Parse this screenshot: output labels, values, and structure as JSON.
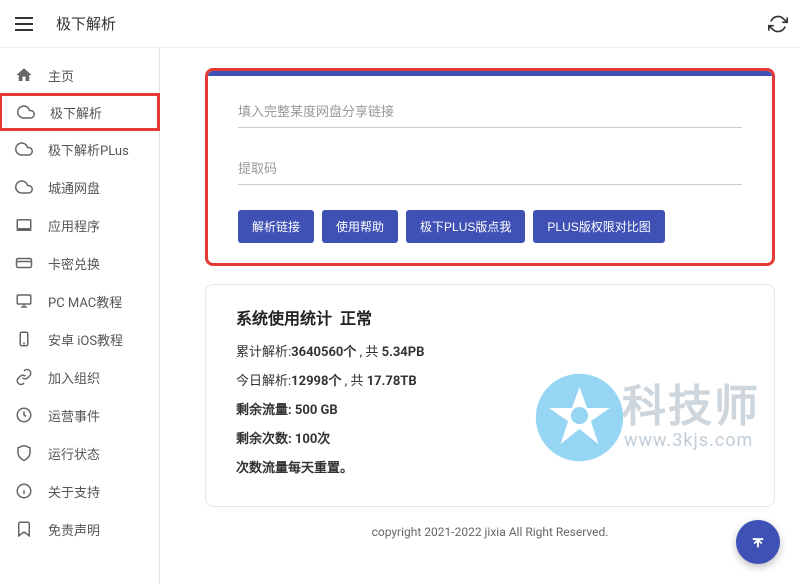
{
  "header": {
    "title": "极下解析"
  },
  "sidebar": {
    "items": [
      {
        "label": "主页",
        "icon": "home",
        "highlighted": false
      },
      {
        "label": "极下解析",
        "icon": "cloud",
        "highlighted": true
      },
      {
        "label": "极下解析PLus",
        "icon": "cloud",
        "highlighted": false
      },
      {
        "label": "城通网盘",
        "icon": "cloud",
        "highlighted": false
      },
      {
        "label": "应用程序",
        "icon": "laptop",
        "highlighted": false
      },
      {
        "label": "卡密兑换",
        "icon": "card",
        "highlighted": false
      },
      {
        "label": "PC MAC教程",
        "icon": "monitor",
        "highlighted": false
      },
      {
        "label": "安卓 iOS教程",
        "icon": "phone",
        "highlighted": false
      },
      {
        "label": "加入组织",
        "icon": "link",
        "highlighted": false
      },
      {
        "label": "运营事件",
        "icon": "clock",
        "highlighted": false
      },
      {
        "label": "运行状态",
        "icon": "shield",
        "highlighted": false
      },
      {
        "label": "关于支持",
        "icon": "info",
        "highlighted": false
      },
      {
        "label": "免责声明",
        "icon": "bookmark",
        "highlighted": false
      }
    ]
  },
  "parse_form": {
    "link_placeholder": "填入完整某度网盘分享链接",
    "code_placeholder": "提取码",
    "buttons": {
      "parse": "解析链接",
      "help": "使用帮助",
      "plus": "极下PLUS版点我",
      "compare": "PLUS版权限对比图"
    }
  },
  "stats": {
    "title": "系统使用统计",
    "status": "正常",
    "total_label": "累计解析:",
    "total_count": "3640560个",
    "total_join": " , 共 ",
    "total_size": "5.34PB",
    "today_label": "今日解析:",
    "today_count": "12998个",
    "today_join": " , 共 ",
    "today_size": "17.78TB",
    "remain_traffic_label": "剩余流量: ",
    "remain_traffic": "500 GB",
    "remain_count_label": "剩余次数: ",
    "remain_count": "100次",
    "reset_note": "次数流量每天重置。"
  },
  "footer": {
    "copyright": "copyright 2021-2022 jixia All Right Reserved."
  },
  "watermark": {
    "title": "科技师",
    "url": "www.3kjs.com"
  }
}
